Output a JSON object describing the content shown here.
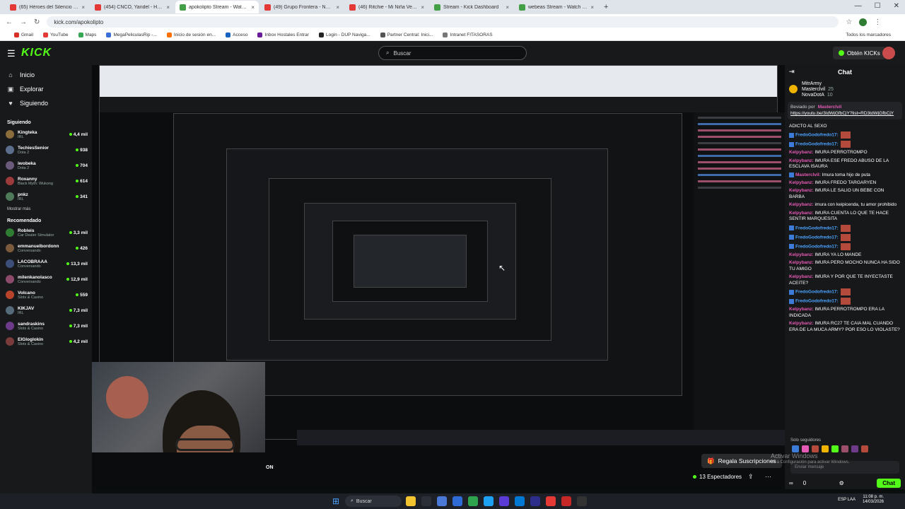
{
  "browser": {
    "tabs": [
      {
        "label": "(65) Héroes del Silencio - Mal",
        "color": "#e53935",
        "active": false
      },
      {
        "label": "(454) CNCO, Yandel - Hoy DJ",
        "color": "#e53935",
        "active": false
      },
      {
        "label": "apokolipto Stream - Watch Live",
        "color": "#43a047",
        "active": true
      },
      {
        "label": "(49) Grupo Frontera - NO SE",
        "color": "#e53935",
        "active": false
      },
      {
        "label": "(46) Ritchie - Mi Niña Veneno",
        "color": "#e53935",
        "active": false
      },
      {
        "label": "Stream - Kick Dashboard",
        "color": "#43a047",
        "active": false
      },
      {
        "label": "webeas Stream - Watch Live o",
        "color": "#43a047",
        "active": false
      }
    ],
    "tab_close": "×",
    "new_tab": "+",
    "window_controls": {
      "minimize": "—",
      "maximize": "☐",
      "close": "✕"
    },
    "url": "kick.com/apokolipto",
    "nav": {
      "back": "←",
      "forward": "→",
      "reload": "↻"
    },
    "addr_icons": {
      "star": "☆",
      "menu": "⋮"
    },
    "bookmarks": [
      {
        "label": "Gmail",
        "color": "#d93025"
      },
      {
        "label": "YouTube",
        "color": "#e53935"
      },
      {
        "label": "Maps",
        "color": "#34a853"
      },
      {
        "label": "MegaPeliculasRip -...",
        "color": "#3b6fd8"
      },
      {
        "label": "Inicio de sesión en...",
        "color": "#ff6f00"
      },
      {
        "label": "Acceso",
        "color": "#1565c0"
      },
      {
        "label": "Inbox Hostales Entrar",
        "color": "#6a1b9a"
      },
      {
        "label": "Login - DUP Naviga...",
        "color": "#222"
      },
      {
        "label": "Partner Central: Inici...",
        "color": "#555"
      },
      {
        "label": "Intranet FITASORAS",
        "color": "#777"
      }
    ],
    "bookmarks_all": "Todos los marcadores"
  },
  "kick": {
    "logo": "KICK",
    "menu_icon": "☰",
    "search_placeholder": "Buscar",
    "search_icon": "⌕",
    "get_kicks": "Obtén KICKs",
    "nav": [
      {
        "icon": "⌂",
        "label": "Inicio"
      },
      {
        "icon": "▣",
        "label": "Explorar"
      },
      {
        "icon": "♥",
        "label": "Siguiendo"
      }
    ],
    "following_title": "Siguiendo",
    "following": [
      {
        "name": "Kingteka",
        "category": "IRL",
        "viewers": "4,4 mil",
        "color": "#8a6d3b"
      },
      {
        "name": "TechiesSenior",
        "category": "Dota 2",
        "viewers": "938",
        "color": "#5b6f8c"
      },
      {
        "name": "iwobeka",
        "category": "Dota 2",
        "viewers": "704",
        "color": "#6c5a7a"
      },
      {
        "name": "Roxanny",
        "category": "Black Myth: Wukong",
        "viewers": "614",
        "color": "#9c3b3b"
      },
      {
        "name": "pnkz",
        "category": "IRL",
        "viewers": "341",
        "color": "#4f7a5a"
      }
    ],
    "show_more": "Mostrar más",
    "recommended_title": "Recomendado",
    "recommended": [
      {
        "name": "Robleis",
        "category": "Car Dealer Simulator",
        "viewers": "3,3 mil",
        "color": "#2e7d32"
      },
      {
        "name": "emmanuelbordonn",
        "category": "Conversando",
        "viewers": "426",
        "color": "#7b5b3c"
      },
      {
        "name": "LACOBRAAA",
        "category": "Conversando",
        "viewers": "13,3 mil",
        "color": "#3c4f7b"
      },
      {
        "name": "milenkanolasco",
        "category": "Conversando",
        "viewers": "12,9 mil",
        "color": "#8c4a6a"
      },
      {
        "name": "Volcano",
        "category": "Slots & Casino",
        "viewers": "559",
        "color": "#b8452b"
      },
      {
        "name": "KIKJAV",
        "category": "IRL",
        "viewers": "7,3 mil",
        "color": "#556b7a"
      },
      {
        "name": "sandraskins",
        "category": "Slots & Casino",
        "viewers": "7,3 mil",
        "color": "#6d3b8a"
      },
      {
        "name": "ElGloglokin",
        "category": "Slots & Casino",
        "viewers": "4,2 mil",
        "color": "#7a3b3b"
      }
    ]
  },
  "stream": {
    "gift_subs": "Regala Suscripciones",
    "gift_icon": "🎁",
    "viewers": "13 Espectadores",
    "share_icon": "⇪",
    "more_icon": "⋯",
    "on_label": "ON",
    "cursor": "↖"
  },
  "chat": {
    "title": "Chat",
    "collapse_icon": "⇥",
    "gifters": [
      {
        "name": "MitrArmy",
        "count": ""
      },
      {
        "name": "Masterclvil",
        "count": "25"
      },
      {
        "name": "NovaDotA",
        "count": "10"
      }
    ],
    "pinned_by": "Beviado por",
    "pinned_user": "Masterclvil",
    "pinned_link": "https://youtu.be/3IdWjGfbCjY?list=RD3tdWjGfbCjY",
    "messages": [
      {
        "user": "",
        "text": "ADICTO AL SEXO",
        "color": "#ffffff",
        "badge": false,
        "emote": false
      },
      {
        "user": "FredoGodofredo17:",
        "text": "",
        "color": "#4aa3ff",
        "badge": true,
        "emote": true
      },
      {
        "user": "FredoGodofredo17:",
        "text": "",
        "color": "#4aa3ff",
        "badge": true,
        "emote": true
      },
      {
        "user": "Kelpybanz:",
        "text": "IMURA PERROTROMPO",
        "color": "#e45ab4",
        "badge": false,
        "emote": false
      },
      {
        "user": "Kelpybanz:",
        "text": "IMURA ESE FREDO ABUSO DE LA ESCLAVA ISAURA",
        "color": "#e45ab4",
        "badge": false,
        "emote": false
      },
      {
        "user": "Masterclvil:",
        "text": "Imura toma hijo de puta",
        "color": "#e45ab4",
        "badge": true,
        "emote": false
      },
      {
        "user": "Kelpybanz:",
        "text": "IMURA FREDO TARGARYEN",
        "color": "#e45ab4",
        "badge": false,
        "emote": false
      },
      {
        "user": "Kelpybanz:",
        "text": "IMURA LE SALIO UN BEBE CON BARBA",
        "color": "#e45ab4",
        "badge": false,
        "emote": false
      },
      {
        "user": "Kelpybanz:",
        "text": "imura con keipicenda, tu amor prohibido",
        "color": "#e45ab4",
        "badge": false,
        "emote": false
      },
      {
        "user": "Kelpybanz:",
        "text": "IMURA CUENTA LO QUE TE HACE SENTIR MARQUESITA",
        "color": "#e45ab4",
        "badge": false,
        "emote": false
      },
      {
        "user": "FredoGodofredo17:",
        "text": "",
        "color": "#4aa3ff",
        "badge": true,
        "emote": true
      },
      {
        "user": "FredoGodofredo17:",
        "text": "",
        "color": "#4aa3ff",
        "badge": true,
        "emote": true
      },
      {
        "user": "FredoGodofredo17:",
        "text": "",
        "color": "#4aa3ff",
        "badge": true,
        "emote": true
      },
      {
        "user": "Kelpybanz:",
        "text": "IMURA YA LO MANDE",
        "color": "#e45ab4",
        "badge": false,
        "emote": false
      },
      {
        "user": "Kelpybanz:",
        "text": "IMURA PERO MOCHO NUNCA HA SIDO TU AMIGO",
        "color": "#e45ab4",
        "badge": false,
        "emote": false
      },
      {
        "user": "Kelpybanz:",
        "text": "IMURA Y POR QUE TE INYECTASTE ACEITE?",
        "color": "#e45ab4",
        "badge": false,
        "emote": false
      },
      {
        "user": "FredoGodofredo17:",
        "text": "",
        "color": "#4aa3ff",
        "badge": true,
        "emote": true
      },
      {
        "user": "FredoGodofredo17:",
        "text": "",
        "color": "#4aa3ff",
        "badge": true,
        "emote": true
      },
      {
        "user": "Kelpybanz:",
        "text": "IMURA PERROTROMPO ERA LA INDICADA",
        "color": "#e45ab4",
        "badge": false,
        "emote": false
      },
      {
        "user": "Kelpybanz:",
        "text": "IMURA RC27 TE CAIA MAL CUANDO ERA DE LA MUCA ARMY? POR ESO LO VIOLASTE?",
        "color": "#e45ab4",
        "badge": false,
        "emote": false
      }
    ],
    "followers_only": "Solo seguidores",
    "input_placeholder": "Enviar mensaje",
    "footer_left": "∞",
    "footer_count": "0",
    "settings_icon": "⚙",
    "send_label": "Chat"
  },
  "windows": {
    "activate_title": "Activar Windows",
    "activate_sub": "Ve a Configuración para activar Windows.",
    "start_icon": "⊞",
    "search_label": "Buscar",
    "apps": [
      "#f4c430",
      "#2b2f38",
      "#4a78d6",
      "#2f6bd6",
      "#2ea44f",
      "#1da1f2",
      "#5b3bd6",
      "#0078d4",
      "#2d2d8c",
      "#e53935",
      "#c62828",
      "#333"
    ],
    "tray_lang": "ESP LAA",
    "time": "11:08 p. m.",
    "date": "14/03/2026"
  }
}
